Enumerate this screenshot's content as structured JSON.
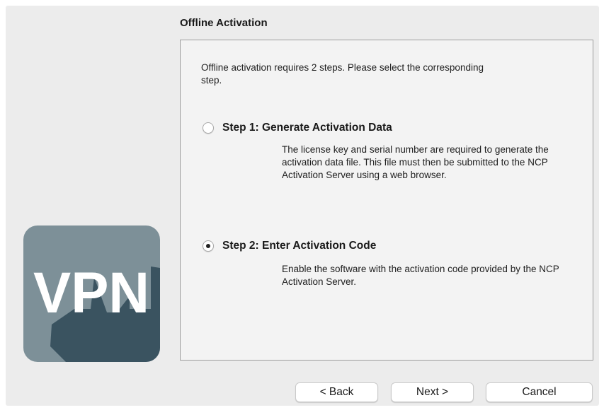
{
  "window": {
    "title": "Offline Activation"
  },
  "logo": {
    "text": "VPN",
    "icon": "vpn-app-icon",
    "bg_color": "#7d9098",
    "shadow_color": "#3a5360"
  },
  "panel": {
    "intro": "Offline activation requires 2 steps. Please select the corresponding step.",
    "options": [
      {
        "label": "Step 1: Generate Activation Data",
        "checked": false,
        "description": "The license key and serial number are required to generate the activation data file. This file must then be submitted to the NCP Activation Server using a web browser."
      },
      {
        "label": "Step 2: Enter Activation Code",
        "checked": true,
        "description": "Enable the software with the activation code provided by the NCP Activation Server."
      }
    ]
  },
  "buttons": {
    "back": "< Back",
    "next": "Next >",
    "cancel": "Cancel"
  }
}
